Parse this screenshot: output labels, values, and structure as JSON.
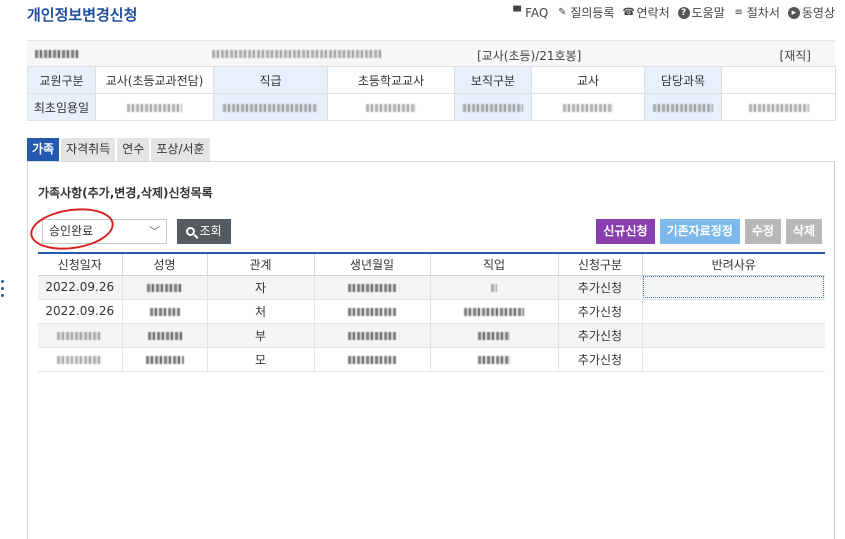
{
  "page": {
    "title": "개인정보변경신청"
  },
  "toplinks": [
    {
      "icon": "faq-icon",
      "label": "FAQ"
    },
    {
      "icon": "pencil-icon",
      "label": "질의등록"
    },
    {
      "icon": "phone-icon",
      "label": "연락처"
    },
    {
      "icon": "help-icon",
      "label": "도움말"
    },
    {
      "icon": "document-icon",
      "label": "절차서"
    },
    {
      "icon": "play-icon",
      "label": "동영상"
    }
  ],
  "profile": {
    "rank_class": "[교사(초등)/21호봉]",
    "status": "[재직]",
    "labels": {
      "staff_type": "교원구분",
      "grade": "직급",
      "position_type": "보직구분",
      "subject": "담당과목",
      "first_appointment": "최초임용일"
    },
    "values": {
      "staff_type": "교사(초등교과전담)",
      "grade": "초등학교교사",
      "position_type": "교사",
      "subject": ""
    }
  },
  "tabs": [
    {
      "label": "가족",
      "active": true
    },
    {
      "label": "자격취득",
      "active": false
    },
    {
      "label": "연수",
      "active": false
    },
    {
      "label": "포상/서훈",
      "active": false
    }
  ],
  "section": {
    "title": "가족사항(추가,변경,삭제)신청목록"
  },
  "filter": {
    "selected": "승인완료",
    "search_label": "조회"
  },
  "actions": {
    "new": "신규신청",
    "correct": "기존자료정정",
    "edit": "수정",
    "delete": "삭제"
  },
  "list": {
    "columns": [
      "신청일자",
      "성명",
      "관계",
      "생년월일",
      "직업",
      "신청구분",
      "반려사유"
    ],
    "rows": [
      {
        "date": "2022.09.26",
        "relation": "자",
        "type": "추가신청",
        "reason": ""
      },
      {
        "date": "2022.09.26",
        "relation": "처",
        "type": "추가신청",
        "reason": ""
      },
      {
        "date": "",
        "relation": "부",
        "type": "추가신청",
        "reason": ""
      },
      {
        "date": "",
        "relation": "모",
        "type": "추가신청",
        "reason": ""
      }
    ]
  },
  "colors": {
    "accent": "#2459b0",
    "title": "#1f4e9e",
    "label_bg": "#e8f1fb",
    "btn_new": "#8a3fb0",
    "btn_correct": "#7cb8ea",
    "btn_muted": "#b8b8b8",
    "annotation": "#d62020"
  }
}
